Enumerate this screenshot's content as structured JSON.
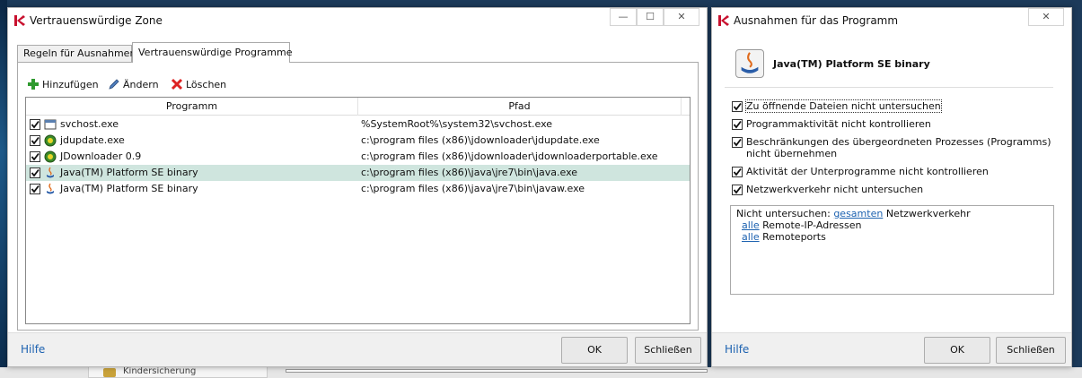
{
  "windows": [
    {
      "title": "Vertrauenswürdige Zone",
      "caption_buttons": [
        "—",
        "☐",
        "✕"
      ],
      "tabs": [
        {
          "label": "Regeln für Ausnahmen",
          "active": false
        },
        {
          "label": "Vertrauenswürdige Programme",
          "active": true
        }
      ],
      "toolbar": {
        "add": "Hinzufügen",
        "edit": "Ändern",
        "delete": "Löschen"
      },
      "columns": {
        "program": "Programm",
        "path": "Pfad"
      },
      "rows": [
        {
          "name": "svchost.exe",
          "path": "%SystemRoot%\\system32\\svchost.exe",
          "checked": true,
          "icon": "exe-file-icon",
          "selected": false
        },
        {
          "name": "jdupdate.exe",
          "path": "c:\\program files (x86)\\jdownloader\\jdupdate.exe",
          "checked": true,
          "icon": "jdownloader-icon",
          "selected": false
        },
        {
          "name": "JDownloader 0.9",
          "path": "c:\\program files (x86)\\jdownloader\\jdownloaderportable.exe",
          "checked": true,
          "icon": "jdownloader-icon",
          "selected": false
        },
        {
          "name": "Java(TM) Platform SE binary",
          "path": "c:\\program files (x86)\\java\\jre7\\bin\\java.exe",
          "checked": true,
          "icon": "java-icon",
          "selected": true
        },
        {
          "name": "Java(TM) Platform SE binary",
          "path": "c:\\program files (x86)\\java\\jre7\\bin\\javaw.exe",
          "checked": true,
          "icon": "java-icon",
          "selected": false
        }
      ],
      "footer": {
        "help": "Hilfe",
        "ok": "OK",
        "close": "Schließen"
      }
    },
    {
      "title": "Ausnahmen für das Programm",
      "caption_buttons": [
        "✕"
      ],
      "program_name": "Java(TM) Platform SE binary",
      "options": [
        {
          "label": "Zu öffnende Dateien nicht untersuchen",
          "checked": true
        },
        {
          "label": "Programmaktivität nicht kontrollieren",
          "checked": true
        },
        {
          "label": "Beschränkungen des übergeordneten Prozesses (Programms)",
          "label2": "nicht übernehmen",
          "checked": true
        },
        {
          "label": "Aktivität der Unterprogramme nicht kontrollieren",
          "checked": true
        },
        {
          "label": "Netzwerkverkehr nicht untersuchen",
          "checked": true
        }
      ],
      "info": {
        "line1_prefix": "Nicht untersuchen:",
        "line1_link": "gesamten",
        "line1_suffix": "Netzwerkverkehr",
        "line2_link": "alle",
        "line2_suffix": "Remote-IP-Adressen",
        "line3_link": "alle",
        "line3_suffix": "Remoteports"
      },
      "footer": {
        "help": "Hilfe",
        "ok": "OK",
        "close": "Schließen"
      }
    }
  ],
  "background": {
    "taskbar_item": "Kindersicherung"
  },
  "colors": {
    "accent_link": "#1b61b0",
    "selected_row": "#cfe5de",
    "kaspersky_red": "#c8102e"
  }
}
